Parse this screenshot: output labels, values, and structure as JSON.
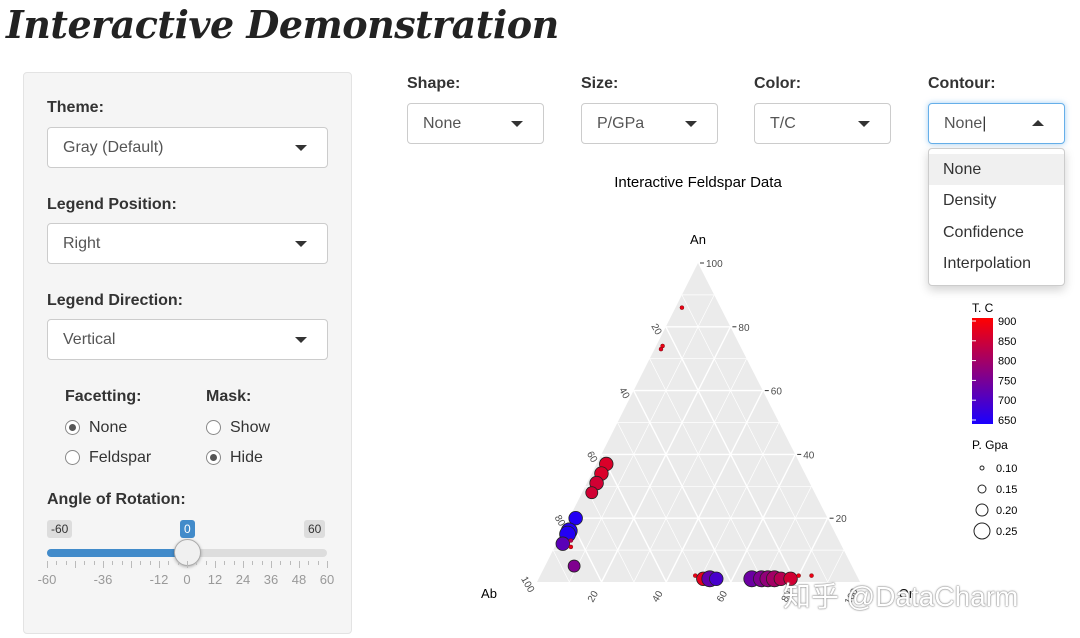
{
  "app_title": "Interactive Demonstration",
  "sidebar": {
    "theme": {
      "label": "Theme:",
      "value": "Gray (Default)"
    },
    "legend_position": {
      "label": "Legend Position:",
      "value": "Right"
    },
    "legend_direction": {
      "label": "Legend Direction:",
      "value": "Vertical"
    },
    "facetting": {
      "label": "Facetting:",
      "options": [
        "None",
        "Feldspar"
      ],
      "selected": "None"
    },
    "mask": {
      "label": "Mask:",
      "options": [
        "Show",
        "Hide"
      ],
      "selected": "Hide"
    },
    "rotation": {
      "label": "Angle of Rotation:",
      "min": "-60",
      "max": "60",
      "value": "0",
      "ticks": [
        "-60",
        "-36",
        "-12",
        "0",
        "12",
        "24",
        "36",
        "48",
        "60"
      ]
    }
  },
  "controls": {
    "shape": {
      "label": "Shape:",
      "value": "None"
    },
    "size": {
      "label": "Size:",
      "value": "P/GPa"
    },
    "color": {
      "label": "Color:",
      "value": "T/C"
    },
    "contour": {
      "label": "Contour:",
      "value": "None",
      "options": [
        "None",
        "Density",
        "Confidence",
        "Interpolation"
      ],
      "highlighted": "None"
    }
  },
  "chart_data": {
    "type": "scatter",
    "title": "Interactive Feldspar Data",
    "axes": {
      "top": "An",
      "left": "Ab",
      "right": "Or"
    },
    "ticks": [
      "20",
      "40",
      "60",
      "80",
      "100"
    ],
    "color_legend": {
      "title": "T. C",
      "range": [
        650,
        900
      ],
      "labels": [
        "900",
        "850",
        "800",
        "750",
        "700",
        "650"
      ],
      "low_color": "#1a00ff",
      "high_color": "#ff0000"
    },
    "size_legend": {
      "title": "P. Gpa",
      "labels": [
        "0.10",
        "0.15",
        "0.20",
        "0.25"
      ]
    },
    "points": [
      {
        "an": 86,
        "ab": 12,
        "or": 2,
        "t": 880,
        "p": 0.1
      },
      {
        "an": 74,
        "ab": 24,
        "or": 2,
        "t": 880,
        "p": 0.1
      },
      {
        "an": 73,
        "ab": 25,
        "or": 2,
        "t": 870,
        "p": 0.1
      },
      {
        "an": 37,
        "ab": 60,
        "or": 3,
        "t": 860,
        "p": 0.22
      },
      {
        "an": 34,
        "ab": 63,
        "or": 3,
        "t": 860,
        "p": 0.22
      },
      {
        "an": 31,
        "ab": 66,
        "or": 3,
        "t": 850,
        "p": 0.22
      },
      {
        "an": 28,
        "ab": 69,
        "or": 3,
        "t": 850,
        "p": 0.2
      },
      {
        "an": 20,
        "ab": 78,
        "or": 2,
        "t": 660,
        "p": 0.22
      },
      {
        "an": 16,
        "ab": 82,
        "or": 2,
        "t": 660,
        "p": 0.25
      },
      {
        "an": 15,
        "ab": 83,
        "or": 2,
        "t": 660,
        "p": 0.25
      },
      {
        "an": 12,
        "ab": 86,
        "or": 2,
        "t": 720,
        "p": 0.22
      },
      {
        "an": 13,
        "ab": 83,
        "or": 4,
        "t": 820,
        "p": 0.1
      },
      {
        "an": 11,
        "ab": 84,
        "or": 5,
        "t": 880,
        "p": 0.1
      },
      {
        "an": 5,
        "ab": 86,
        "or": 9,
        "t": 760,
        "p": 0.2
      },
      {
        "an": 2,
        "ab": 50,
        "or": 48,
        "t": 880,
        "p": 0.1
      },
      {
        "an": 1,
        "ab": 48,
        "or": 51,
        "t": 870,
        "p": 0.22
      },
      {
        "an": 1,
        "ab": 46,
        "or": 53,
        "t": 730,
        "p": 0.25
      },
      {
        "an": 1,
        "ab": 44,
        "or": 55,
        "t": 700,
        "p": 0.22
      },
      {
        "an": 1,
        "ab": 33,
        "or": 66,
        "t": 740,
        "p": 0.25
      },
      {
        "an": 1,
        "ab": 30,
        "or": 69,
        "t": 760,
        "p": 0.25
      },
      {
        "an": 1,
        "ab": 28,
        "or": 71,
        "t": 780,
        "p": 0.25
      },
      {
        "an": 1,
        "ab": 26,
        "or": 73,
        "t": 800,
        "p": 0.25
      },
      {
        "an": 1,
        "ab": 24,
        "or": 75,
        "t": 820,
        "p": 0.22
      },
      {
        "an": 1,
        "ab": 21,
        "or": 78,
        "t": 850,
        "p": 0.22
      },
      {
        "an": 2,
        "ab": 18,
        "or": 80,
        "t": 880,
        "p": 0.1
      },
      {
        "an": 2,
        "ab": 14,
        "or": 84,
        "t": 880,
        "p": 0.1
      }
    ]
  },
  "watermark": "知乎 @DataCharm"
}
